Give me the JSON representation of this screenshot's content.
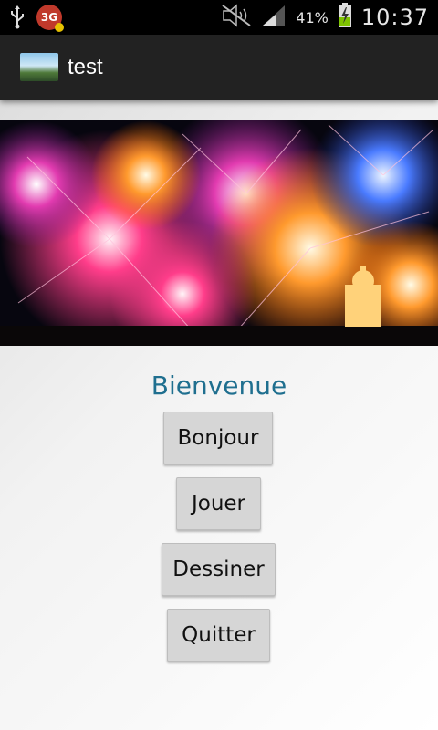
{
  "status_bar": {
    "network_badge": "3G",
    "battery_percent": "41%",
    "time": "10:37",
    "icons": [
      "usb-icon",
      "network-3g-icon",
      "no-signal-icon",
      "signal-strength-icon",
      "battery-charging-icon"
    ]
  },
  "action_bar": {
    "title": "test",
    "icon": "app-thumbnail-icon"
  },
  "main": {
    "welcome_text": "Bienvenue",
    "buttons": [
      {
        "label": "Bonjour"
      },
      {
        "label": "Jouer"
      },
      {
        "label": "Dessiner"
      },
      {
        "label": "Quitter"
      }
    ]
  },
  "colors": {
    "accent": "#1f6f8f",
    "action_bar_bg": "#222222",
    "status_bar_bg": "#000000",
    "battery_fill": "#7ec300",
    "badge_bg": "#c0392b"
  }
}
